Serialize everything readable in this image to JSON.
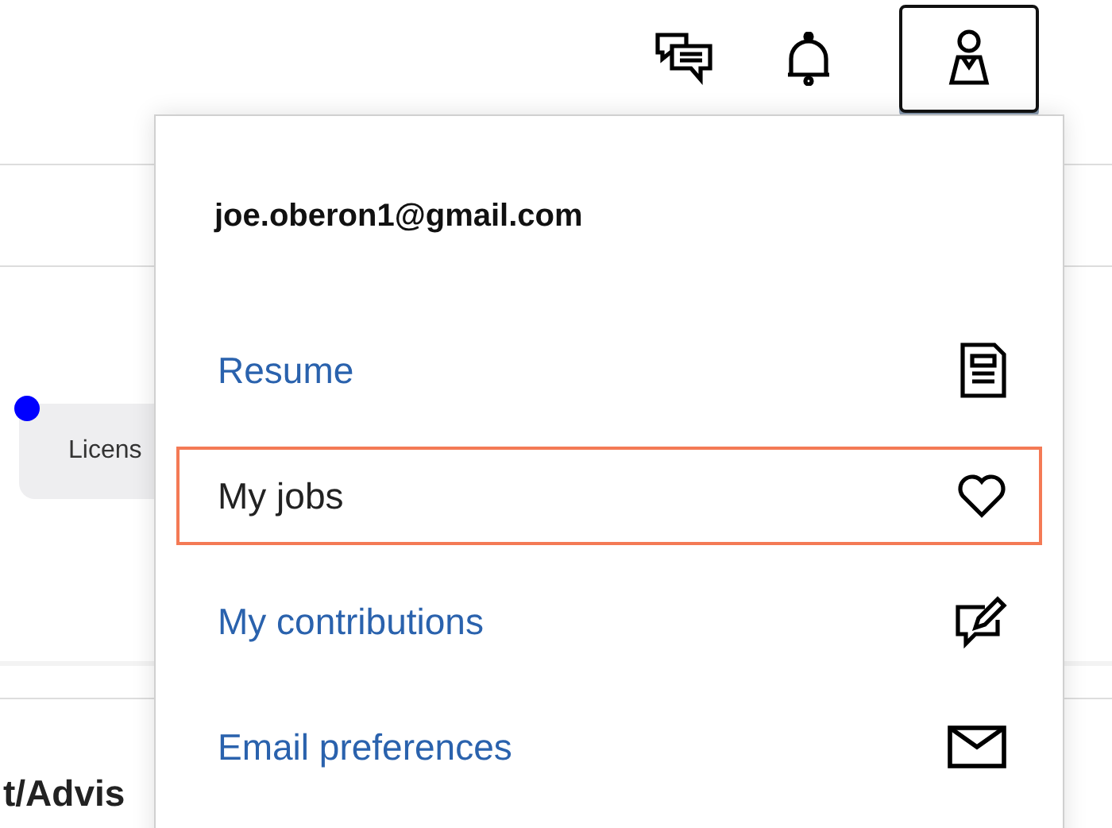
{
  "header": {
    "account_button": {
      "selected": true
    }
  },
  "background": {
    "chip": {
      "label": "Licens",
      "color": "#0000ff"
    },
    "heading": "t/Advis"
  },
  "account_menu": {
    "email": "joe.oberon1@gmail.com",
    "items": [
      {
        "label": "Resume",
        "highlighted": false
      },
      {
        "label": "My jobs",
        "highlighted": true
      },
      {
        "label": "My contributions",
        "highlighted": false
      },
      {
        "label": "Email preferences",
        "highlighted": false
      }
    ]
  }
}
